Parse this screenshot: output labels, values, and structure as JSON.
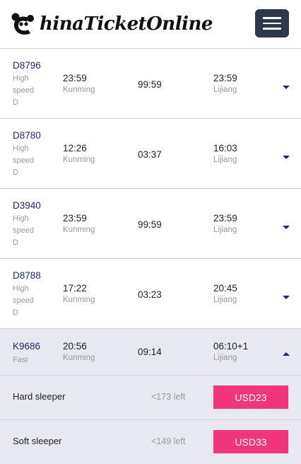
{
  "header": {
    "logo_text": "hinaTicketOnline",
    "logo_alt": "China Ticket Online"
  },
  "trains": [
    {
      "id": "D8796",
      "type": [
        "High",
        "speed",
        "D"
      ],
      "dep_time": "23:59",
      "dep_city": "Kunming",
      "duration": "99:59",
      "arr_time": "23:59",
      "arr_city": "Lijiang"
    },
    {
      "id": "D8780",
      "type": [
        "High",
        "speed",
        "D"
      ],
      "dep_time": "12:26",
      "dep_city": "Kunming",
      "duration": "03:37",
      "arr_time": "16:03",
      "arr_city": "Lijiang"
    },
    {
      "id": "D3940",
      "type": [
        "High",
        "speed",
        "D"
      ],
      "dep_time": "23:59",
      "dep_city": "Kunming",
      "duration": "99:59",
      "arr_time": "23:59",
      "arr_city": "Lijiang"
    },
    {
      "id": "D8788",
      "type": [
        "High",
        "speed",
        "D"
      ],
      "dep_time": "17:22",
      "dep_city": "Kunming",
      "duration": "03:23",
      "arr_time": "20:45",
      "arr_city": "Lijiang"
    }
  ],
  "expanded": {
    "id": "K9686",
    "type": "Fast",
    "dep_time": "20:56",
    "dep_city": "Kunming",
    "duration": "09:14",
    "arr_time": "06:10+1",
    "arr_city": "Lijiang",
    "seats": [
      {
        "name": "Hard sleeper",
        "left": "<173 left",
        "price": "USD23"
      },
      {
        "name": "Soft sleeper",
        "left": "<149 left",
        "price": "USD33"
      }
    ]
  },
  "colors": {
    "accent_navy": "#1f2a6b",
    "price_pink": "#f0357a",
    "menu_button": "#2e3a4a",
    "expanded_bg": "#e7e8f2"
  },
  "icons": {
    "menu": "hamburger-icon",
    "expand": "chevron-down-icon",
    "collapse": "chevron-up-icon",
    "logo": "panda-icon"
  }
}
